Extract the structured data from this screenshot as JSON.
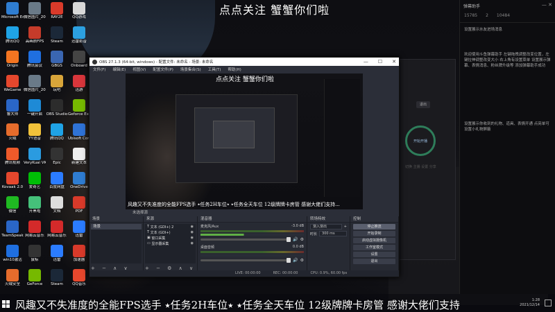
{
  "overlay": {
    "top_title": "点点关注 蟹蟹你们啦",
    "bottom_ticker": "风趣又不失准度的全能FPS选手 ⭑任务2H车位⭑ ⭑任务全天车位 12级牌牌卡房管 感谢大佬们支持"
  },
  "desktop_icons": [
    {
      "label": "Microsoft Edge",
      "color": "#2f7dd1"
    },
    {
      "label": "微信图片_2021100...",
      "color": "#6a7a88"
    },
    {
      "label": "RAY2E",
      "color": "#d93a2a"
    },
    {
      "label": "QQ游戏",
      "color": "#d8d8d8"
    },
    {
      "label": "腾讯QQ",
      "color": "#1fa3e6"
    },
    {
      "label": "高画质FPS",
      "color": "#c53b2a"
    },
    {
      "label": "Steam",
      "color": "#1b2838"
    },
    {
      "label": "迅雷影音",
      "color": "#2ca0e0"
    },
    {
      "label": "Origin",
      "color": "#f47521"
    },
    {
      "label": "腾讯会议",
      "color": "#1f6fe0"
    },
    {
      "label": "GBGS",
      "color": "#3a66b2"
    },
    {
      "label": "Onboard",
      "color": "#444"
    },
    {
      "label": "WeGame",
      "color": "#e5472d"
    },
    {
      "label": "微信图片_2021100...",
      "color": "#6a7a88"
    },
    {
      "label": "玩吧",
      "color": "#d8a53a"
    },
    {
      "label": "迅游",
      "color": "#d8363b"
    },
    {
      "label": "鲁大师",
      "color": "#2a66c7"
    },
    {
      "label": "一键开启",
      "color": "#1e8ad6"
    },
    {
      "label": "OBS Studio",
      "color": "#2c2c2c"
    },
    {
      "label": "Geforce Experience",
      "color": "#76b900"
    },
    {
      "label": "火绒",
      "color": "#e66c2c"
    },
    {
      "label": "YY语音",
      "color": "#f2c23a"
    },
    {
      "label": "腾讯QQ",
      "color": "#1fa3e6"
    },
    {
      "label": "Ubisoft Connect",
      "color": "#2f73d6"
    },
    {
      "label": "腾讯视频",
      "color": "#ee5a2a"
    },
    {
      "label": "VeryKuai VK",
      "color": "#2a9be0"
    },
    {
      "label": "Epic",
      "color": "#333"
    },
    {
      "label": "新建文本",
      "color": "#eee"
    },
    {
      "label": "Kovaak 2.0",
      "color": "#e5472d"
    },
    {
      "label": "爱奇艺",
      "color": "#00be06"
    },
    {
      "label": "百度网盘",
      "color": "#2b7cff"
    },
    {
      "label": "OneDrive",
      "color": "#2f7dd1"
    },
    {
      "label": "微信",
      "color": "#1fb922"
    },
    {
      "label": "开黑啦",
      "color": "#45c17a"
    },
    {
      "label": "文档",
      "color": "#ddd"
    },
    {
      "label": "PDF",
      "color": "#d93a2a"
    },
    {
      "label": "TeamSpeak",
      "color": "#2a66c7"
    },
    {
      "label": "网易云音乐",
      "color": "#d42a2a"
    },
    {
      "label": "网易云音乐",
      "color": "#d42a2a"
    },
    {
      "label": "迅雷",
      "color": "#2b7cff"
    },
    {
      "label": "win10激活",
      "color": "#1f6fe0"
    },
    {
      "label": "鼠标",
      "color": "#333"
    },
    {
      "label": "迅雷",
      "color": "#2b7cff"
    },
    {
      "label": "加速器",
      "color": "#d93a2a"
    },
    {
      "label": "火绒安全",
      "color": "#e66c2c"
    },
    {
      "label": "GeForce",
      "color": "#76b900"
    },
    {
      "label": "Steam",
      "color": "#1b2838"
    },
    {
      "label": "QQ音乐",
      "color": "#e5472d"
    }
  ],
  "right_panel": {
    "title": "弹幕助手",
    "stats": [
      "15785",
      "2",
      "10484"
    ],
    "text_block_1": "设置展示水友进场消息",
    "text_block_2": "欢迎使用斗鱼弹幕助手 左键拖拽调整改变位置，左键拉伸调整改变大小 右上角有设置菜单 设置展示弹幕、表情消息、粉丝牌升级等 添加弹幕助手成功",
    "text_block_3": "设置展示你收到的礼物、道具、表情开通 点亮单可设置小礼物屏蔽"
  },
  "live_app": {
    "button": "退出",
    "circle_label": "开始开播",
    "lines": "切换 主播 设置 分享"
  },
  "obs": {
    "title": "OBS 27.1.3 (64-bit, windows) - 配置文件: 未命名 - 场景: 未命名",
    "window_controls": [
      "—",
      "☐",
      "✕"
    ],
    "menu": [
      "文件(F)",
      "编辑(E)",
      "视图(V)",
      "配置文件(P)",
      "场景集合(S)",
      "工具(T)",
      "帮助(H)"
    ],
    "preview": {
      "title": "点点关注 蟹蟹你们啦",
      "ticker": "风趣又不失准度的全能FPS选手 ⭑任务2H车位⭑ ⭑任务全天车位 12级牌牌卡房管 感谢大佬们支持..."
    },
    "controls_bar": "未选择源",
    "scenes": {
      "header": "场景",
      "items": [
        "场景"
      ],
      "footer": "+ − ∧ ∨"
    },
    "sources": {
      "header": "来源",
      "items": [
        {
          "icon": "T",
          "label": "文本 (GDI+) 2"
        },
        {
          "icon": "T",
          "label": "文本 (GDI+)"
        },
        {
          "icon": "▣",
          "label": "窗口采集"
        },
        {
          "icon": "▭",
          "label": "显示器采集"
        }
      ],
      "footer": "+ − ⚙ ∧ ∨"
    },
    "mixer": {
      "header": "混音器",
      "tracks": [
        {
          "name": "麦克风/Aux",
          "db": "-3.0 dB",
          "level": 0.42
        },
        {
          "name": "桌面音频",
          "db": "0.0 dB",
          "level": 0.0
        }
      ]
    },
    "transitions": {
      "header": "转场特效",
      "selected": "渐入渐出",
      "duration_label": "时长",
      "duration_value": "300 ms"
    },
    "controls": {
      "header": "控制",
      "buttons": [
        {
          "label": "停止推流",
          "active": true
        },
        {
          "label": "开始录制",
          "active": false
        },
        {
          "label": "启动虚拟摄像机",
          "active": false
        },
        {
          "label": "工作室模式",
          "active": false
        },
        {
          "label": "设置",
          "active": false
        },
        {
          "label": "退出",
          "active": false
        }
      ]
    },
    "status": [
      "LIVE: 00:00:00",
      "REC: 00:00:00",
      "CPU: 0.9%, 60.00 fps"
    ]
  },
  "taskbar": {
    "time": "1:28",
    "date": "2021/12/14"
  }
}
